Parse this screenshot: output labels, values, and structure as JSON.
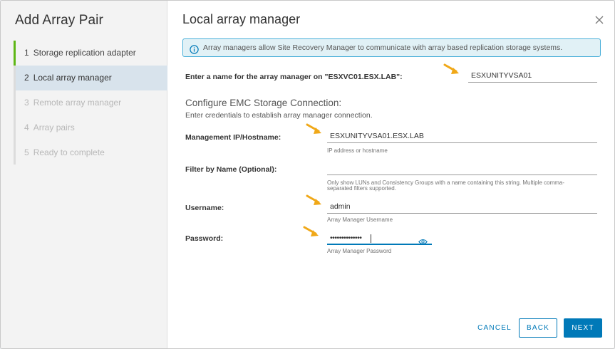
{
  "sidebar": {
    "title": "Add Array Pair",
    "steps": [
      {
        "num": "1",
        "label": "Storage replication adapter"
      },
      {
        "num": "2",
        "label": "Local array manager"
      },
      {
        "num": "3",
        "label": "Remote array manager"
      },
      {
        "num": "4",
        "label": "Array pairs"
      },
      {
        "num": "5",
        "label": "Ready to complete"
      }
    ]
  },
  "main": {
    "title": "Local array manager",
    "info_text": "Array managers allow Site Recovery Manager to communicate with array based replication storage systems.",
    "name_label": "Enter a name for the array manager on \"ESXVC01.ESX.LAB\":",
    "name_value": "ESXUNITYVSA01",
    "section_title": "Configure EMC Storage Connection:",
    "section_subtitle": "Enter credentials to establish array manager connection.",
    "mgmt": {
      "label": "Management IP/Hostname:",
      "value": "ESXUNITYVSA01.ESX.LAB",
      "helper": "IP address or hostname"
    },
    "filter": {
      "label": "Filter by Name (Optional):",
      "value": "",
      "helper_line1": "Only show LUNs and Consistency Groups with a name containing this string. Multiple comma-",
      "helper_line2": "separated filters supported."
    },
    "username": {
      "label": "Username:",
      "value": "admin",
      "helper": "Array Manager Username"
    },
    "password": {
      "label": "Password:",
      "value": "••••••••••••••",
      "helper": "Array Manager Password"
    }
  },
  "footer": {
    "cancel_label": "CANCEL",
    "back_label": "BACK",
    "next_label": "NEXT"
  },
  "colors": {
    "accent": "#0079b8",
    "completed_step": "#5eb715",
    "active_step_bg": "#d8e3ec",
    "info_bg": "#e1f1f6",
    "arrow": "#f0a818"
  },
  "icons": [
    "close-icon",
    "info-icon",
    "arrow-pointer-icon",
    "eye-icon"
  ]
}
